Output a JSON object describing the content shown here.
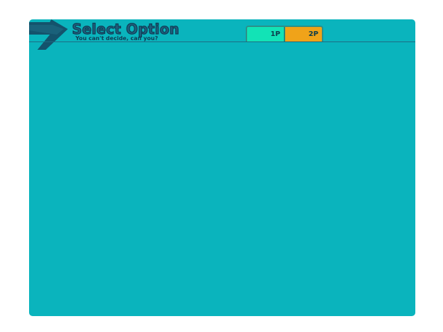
{
  "header": {
    "title": "Select Option",
    "subtitle": "You can't decide, can you?",
    "icon": "arrow-right-icon"
  },
  "player_tabs": [
    {
      "label": "1P",
      "color": "#12e3b6"
    },
    {
      "label": "2P",
      "color": "#f0a319"
    }
  ],
  "colors": {
    "background": "#0ab4bd",
    "title": "#1f5f7d",
    "outline": "#0f3d55"
  }
}
